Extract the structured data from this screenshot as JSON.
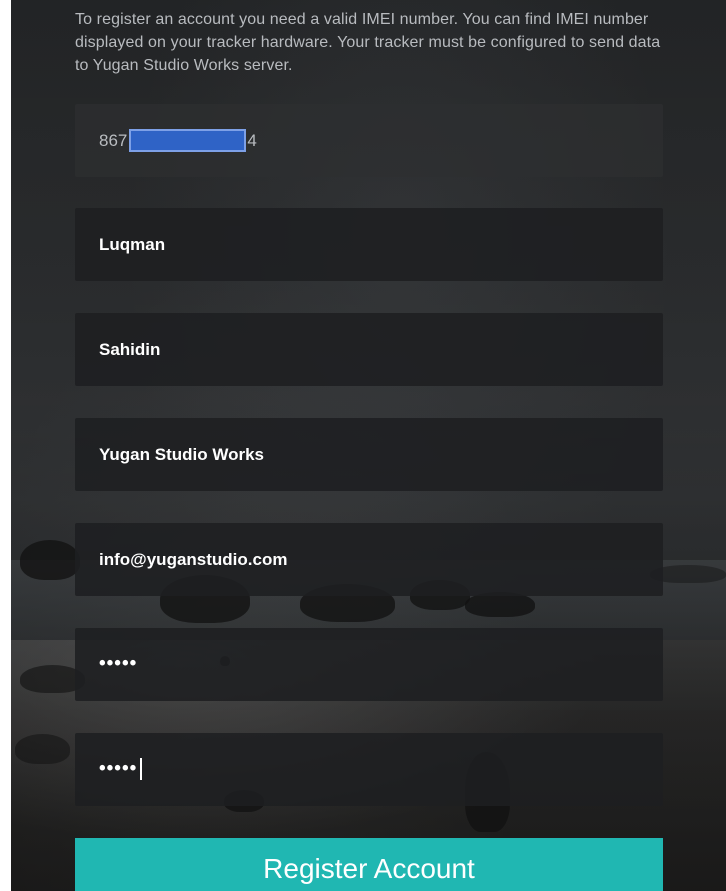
{
  "page": {
    "intro_text": "To register an account you need a valid IMEI number. You can find IMEI number displayed on your tracker hardware. Your tracker must be configured to send data to Yugan Studio Works server."
  },
  "form": {
    "imei_visible_prefix": "867",
    "imei_visible_suffix": "4",
    "first_name": "Luqman",
    "last_name": "Sahidin",
    "company": "Yugan Studio Works",
    "email": "info@yuganstudio.com",
    "password_mask": "•••••",
    "confirm_password_mask": "•••••"
  },
  "actions": {
    "register_label": "Register Account"
  }
}
